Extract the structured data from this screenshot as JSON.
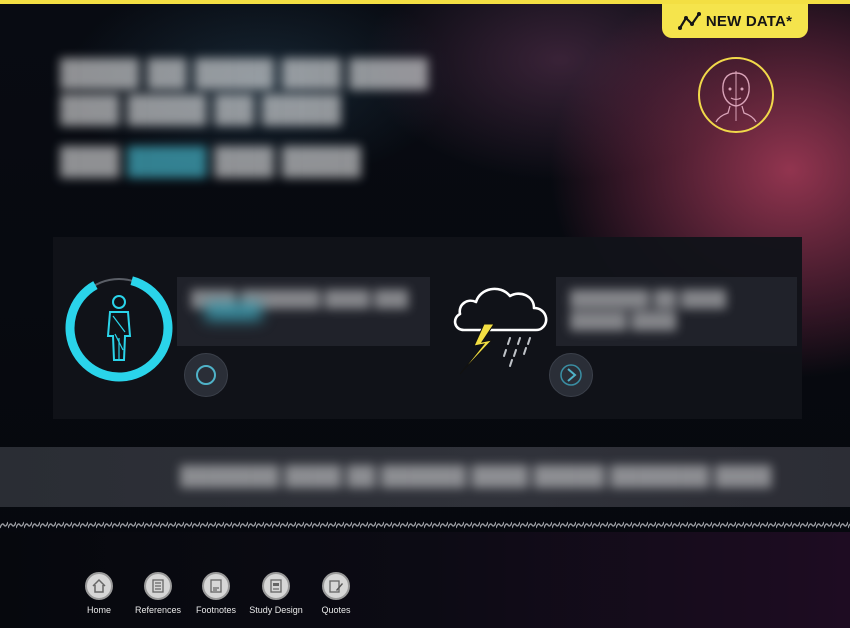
{
  "badge": {
    "label": "NEW DATA*"
  },
  "colors": {
    "accent_yellow": "#f5e44c",
    "accent_cyan": "#2ad4ea",
    "background": "#05070d"
  },
  "icons": {
    "badge": "trend-line-icon",
    "avatar": "face-profile-icon",
    "left_card": "person-progress-ring-icon",
    "right_card": "storm-cloud-icon",
    "record": "record-circle-icon",
    "next": "chevron-right-icon"
  },
  "nav": [
    {
      "label": "Home",
      "icon": "home-icon"
    },
    {
      "label": "References",
      "icon": "list-document-icon"
    },
    {
      "label": "Footnotes",
      "icon": "footnote-document-icon"
    },
    {
      "label": "Study Design",
      "icon": "study-design-icon"
    },
    {
      "label": "Quotes",
      "icon": "quote-pen-icon"
    }
  ]
}
